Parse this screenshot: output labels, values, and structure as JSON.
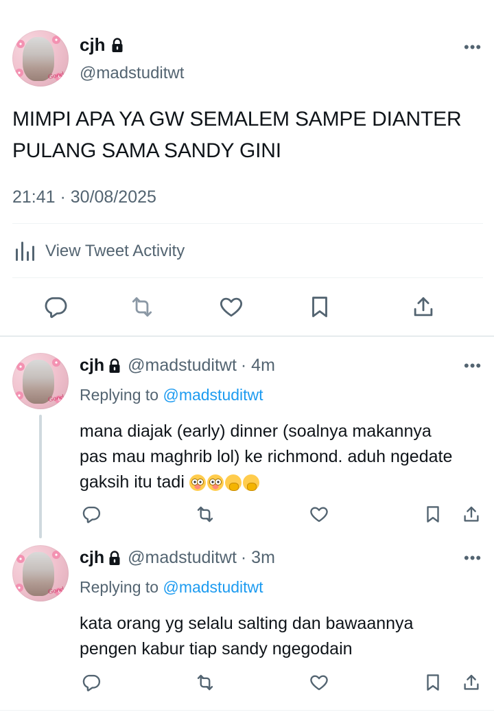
{
  "main_tweet": {
    "name": "cjh",
    "handle": "@madstuditwt",
    "text_line1": "MIMPI APA YA GW SEMALEM SAMPE DIANTER",
    "text_line2": "PULANG SAMA SANDY GINI",
    "timestamp": "21:41 · 30/08/2025",
    "activity_label": "View Tweet Activity",
    "more_label": "•••"
  },
  "replies": [
    {
      "name": "cjh",
      "handle": "@madstuditwt",
      "time": "· 4m",
      "replying_prefix": "Replying to",
      "replying_handle": "@madstuditwt",
      "text_line1": "mana diajak (early) dinner (soalnya makannya",
      "text_line2": "pas mau maghrib lol) ke richmond. aduh ngedate",
      "text_line3": "gaksih itu tadi",
      "more_label": "•••"
    },
    {
      "name": "cjh",
      "handle": "@madstuditwt",
      "time": "· 3m",
      "replying_prefix": "Replying to",
      "replying_handle": "@madstuditwt",
      "text_line1": "kata orang yg selalu salting dan bawaannya",
      "text_line2": "pengen kabur tiap sandy ngegodain",
      "more_label": "•••"
    }
  ],
  "colors": {
    "text": "#0f1419",
    "muted": "#536471",
    "link": "#1d9bf0",
    "divider": "#eff3f4"
  },
  "icons": [
    "lock-icon",
    "reply-icon",
    "retweet-icon",
    "like-icon",
    "bookmark-icon",
    "share-icon",
    "activity-icon",
    "more-icon"
  ]
}
